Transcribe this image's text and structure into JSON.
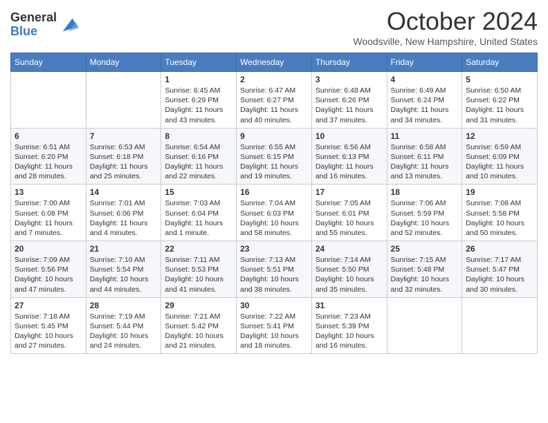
{
  "header": {
    "logo_general": "General",
    "logo_blue": "Blue",
    "title": "October 2024",
    "location": "Woodsville, New Hampshire, United States"
  },
  "days_of_week": [
    "Sunday",
    "Monday",
    "Tuesday",
    "Wednesday",
    "Thursday",
    "Friday",
    "Saturday"
  ],
  "weeks": [
    [
      {
        "day": "",
        "content": ""
      },
      {
        "day": "",
        "content": ""
      },
      {
        "day": "1",
        "content": "Sunrise: 6:45 AM\nSunset: 6:29 PM\nDaylight: 11 hours and 43 minutes."
      },
      {
        "day": "2",
        "content": "Sunrise: 6:47 AM\nSunset: 6:27 PM\nDaylight: 11 hours and 40 minutes."
      },
      {
        "day": "3",
        "content": "Sunrise: 6:48 AM\nSunset: 6:26 PM\nDaylight: 11 hours and 37 minutes."
      },
      {
        "day": "4",
        "content": "Sunrise: 6:49 AM\nSunset: 6:24 PM\nDaylight: 11 hours and 34 minutes."
      },
      {
        "day": "5",
        "content": "Sunrise: 6:50 AM\nSunset: 6:22 PM\nDaylight: 11 hours and 31 minutes."
      }
    ],
    [
      {
        "day": "6",
        "content": "Sunrise: 6:51 AM\nSunset: 6:20 PM\nDaylight: 11 hours and 28 minutes."
      },
      {
        "day": "7",
        "content": "Sunrise: 6:53 AM\nSunset: 6:18 PM\nDaylight: 11 hours and 25 minutes."
      },
      {
        "day": "8",
        "content": "Sunrise: 6:54 AM\nSunset: 6:16 PM\nDaylight: 11 hours and 22 minutes."
      },
      {
        "day": "9",
        "content": "Sunrise: 6:55 AM\nSunset: 6:15 PM\nDaylight: 11 hours and 19 minutes."
      },
      {
        "day": "10",
        "content": "Sunrise: 6:56 AM\nSunset: 6:13 PM\nDaylight: 11 hours and 16 minutes."
      },
      {
        "day": "11",
        "content": "Sunrise: 6:58 AM\nSunset: 6:11 PM\nDaylight: 11 hours and 13 minutes."
      },
      {
        "day": "12",
        "content": "Sunrise: 6:59 AM\nSunset: 6:09 PM\nDaylight: 11 hours and 10 minutes."
      }
    ],
    [
      {
        "day": "13",
        "content": "Sunrise: 7:00 AM\nSunset: 6:08 PM\nDaylight: 11 hours and 7 minutes."
      },
      {
        "day": "14",
        "content": "Sunrise: 7:01 AM\nSunset: 6:06 PM\nDaylight: 11 hours and 4 minutes."
      },
      {
        "day": "15",
        "content": "Sunrise: 7:03 AM\nSunset: 6:04 PM\nDaylight: 11 hours and 1 minute."
      },
      {
        "day": "16",
        "content": "Sunrise: 7:04 AM\nSunset: 6:03 PM\nDaylight: 10 hours and 58 minutes."
      },
      {
        "day": "17",
        "content": "Sunrise: 7:05 AM\nSunset: 6:01 PM\nDaylight: 10 hours and 55 minutes."
      },
      {
        "day": "18",
        "content": "Sunrise: 7:06 AM\nSunset: 5:59 PM\nDaylight: 10 hours and 52 minutes."
      },
      {
        "day": "19",
        "content": "Sunrise: 7:08 AM\nSunset: 5:58 PM\nDaylight: 10 hours and 50 minutes."
      }
    ],
    [
      {
        "day": "20",
        "content": "Sunrise: 7:09 AM\nSunset: 5:56 PM\nDaylight: 10 hours and 47 minutes."
      },
      {
        "day": "21",
        "content": "Sunrise: 7:10 AM\nSunset: 5:54 PM\nDaylight: 10 hours and 44 minutes."
      },
      {
        "day": "22",
        "content": "Sunrise: 7:11 AM\nSunset: 5:53 PM\nDaylight: 10 hours and 41 minutes."
      },
      {
        "day": "23",
        "content": "Sunrise: 7:13 AM\nSunset: 5:51 PM\nDaylight: 10 hours and 38 minutes."
      },
      {
        "day": "24",
        "content": "Sunrise: 7:14 AM\nSunset: 5:50 PM\nDaylight: 10 hours and 35 minutes."
      },
      {
        "day": "25",
        "content": "Sunrise: 7:15 AM\nSunset: 5:48 PM\nDaylight: 10 hours and 32 minutes."
      },
      {
        "day": "26",
        "content": "Sunrise: 7:17 AM\nSunset: 5:47 PM\nDaylight: 10 hours and 30 minutes."
      }
    ],
    [
      {
        "day": "27",
        "content": "Sunrise: 7:18 AM\nSunset: 5:45 PM\nDaylight: 10 hours and 27 minutes."
      },
      {
        "day": "28",
        "content": "Sunrise: 7:19 AM\nSunset: 5:44 PM\nDaylight: 10 hours and 24 minutes."
      },
      {
        "day": "29",
        "content": "Sunrise: 7:21 AM\nSunset: 5:42 PM\nDaylight: 10 hours and 21 minutes."
      },
      {
        "day": "30",
        "content": "Sunrise: 7:22 AM\nSunset: 5:41 PM\nDaylight: 10 hours and 18 minutes."
      },
      {
        "day": "31",
        "content": "Sunrise: 7:23 AM\nSunset: 5:39 PM\nDaylight: 10 hours and 16 minutes."
      },
      {
        "day": "",
        "content": ""
      },
      {
        "day": "",
        "content": ""
      }
    ]
  ]
}
